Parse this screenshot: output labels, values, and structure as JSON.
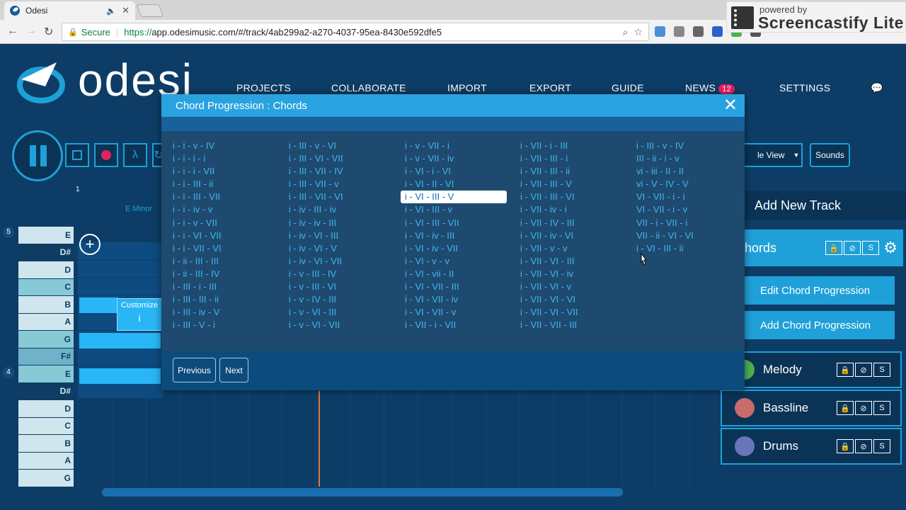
{
  "browser": {
    "tab_title": "Odesi",
    "audio_icon": "🔈",
    "close_glyph": "✕",
    "window_controls": "– ❐ ✕",
    "secure_label": "Secure",
    "url_prefix": "https://",
    "url_body": "app.odesimusic.com/#/track/4ab299a2-a270-4037-95ea-8430e592dfe5",
    "screencastify_small": "powered by",
    "screencastify_brand": "Screencastify Lite"
  },
  "app": {
    "logo_text": "odesi",
    "nav": [
      {
        "label": "PROJECTS"
      },
      {
        "label": "COLLABORATE"
      },
      {
        "label": "IMPORT"
      },
      {
        "label": "EXPORT"
      },
      {
        "label": "GUIDE"
      },
      {
        "label": "NEWS"
      },
      {
        "label": "SETTINGS"
      }
    ],
    "news_count": "12",
    "ruler_number": "1",
    "chord_label": "E Minor",
    "piano_keys": [
      "E",
      "D#",
      "D",
      "C",
      "B",
      "A",
      "G",
      "F#",
      "E",
      "D#",
      "D",
      "C",
      "B",
      "A",
      "G"
    ],
    "octave_labels": [
      "5",
      "4"
    ],
    "customize_label": "Customize",
    "customize_value": "i",
    "view_select_label": "le View",
    "sounds_label": "Sounds",
    "add_track_label": "Add New Track",
    "chords_track_label": "hords",
    "edit_chord_label": "Edit Chord Progression",
    "add_chord_label": "Add Chord Progression",
    "tracks": [
      {
        "name": "Melody",
        "color": "#4caf50"
      },
      {
        "name": "Bassline",
        "color": "#c96b6b"
      },
      {
        "name": "Drums",
        "color": "#6a74b8"
      }
    ],
    "track_icons": {
      "lock": "🔒",
      "hide": "⊘",
      "solo": "S"
    }
  },
  "modal": {
    "title": "Chord Progression : Chords",
    "close": "✕",
    "selected": "i - VI - III - V",
    "columns": [
      [
        "i - i - v - IV",
        "i - i - i - i",
        "i - i - i - VII",
        "i - i - III - ii",
        "i - i - III - VII",
        "i - i - iv - v",
        "i - i - v - VII",
        "i - i - VI - VII",
        "i - i - VII - VI",
        "i - ii - III - III",
        "i - ii - III - IV",
        "i - III - i - III",
        "i - III - III - ii",
        "i - III - iv - V",
        "i - III - V - i"
      ],
      [
        "i - III - v - VI",
        "i - III - VI - VII",
        "i - III - VII - IV",
        "i - III - VII - v",
        "i - III - VII - VI",
        "i - iv - III - iv",
        "i - iv - iv - III",
        "i - iv - VI - III",
        "i - iv - VI - V",
        "i - iv - VI - VII",
        "i - v - III - IV",
        "i - v - III - VI",
        "i - v - IV - III",
        "i - v - VI - III",
        "i - v - VI - VII"
      ],
      [
        "i - v - VII - i",
        "i - v - VII - iv",
        "i - VI - i - VI",
        "i - VI - II - VI",
        "i - VI - III - V",
        "i - VI - III - v",
        "i - VI - III - VII",
        "i - VI - iv - III",
        "i - VI - iv - VII",
        "i - VI - v - v",
        "i - VI - vii - II",
        "i - VI - VII - III",
        "i - VI - VII - iv",
        "i - VI - VII - v",
        "i - VII - i - VII"
      ],
      [
        "i - VII - i - III",
        "i - VII - III - i",
        "i - VII - III - ii",
        "i - VII - III - V",
        "i - VII - III - VI",
        "i - VII - iv - i",
        "i - VII - IV - III",
        "i - VII - iv - VI",
        "i - VII - v - v",
        "i - VII - VI - III",
        "i - VII - VI - iv",
        "i - VII - VI - v",
        "i - VII - VI - VI",
        "i - VII - VI - VII",
        "i - VII - VII - III"
      ],
      [
        "i - III - v - IV",
        "III - ii - i - v",
        "vi - iii - II - II",
        "vi - V - IV - V",
        "VI - VII - i - i",
        "VI - VII - i - v",
        "VII - i - VII - i",
        "VII - ii - VI - VI",
        "i - VI - III - ii"
      ]
    ],
    "previous_label": "Previous",
    "next_label": "Next"
  }
}
